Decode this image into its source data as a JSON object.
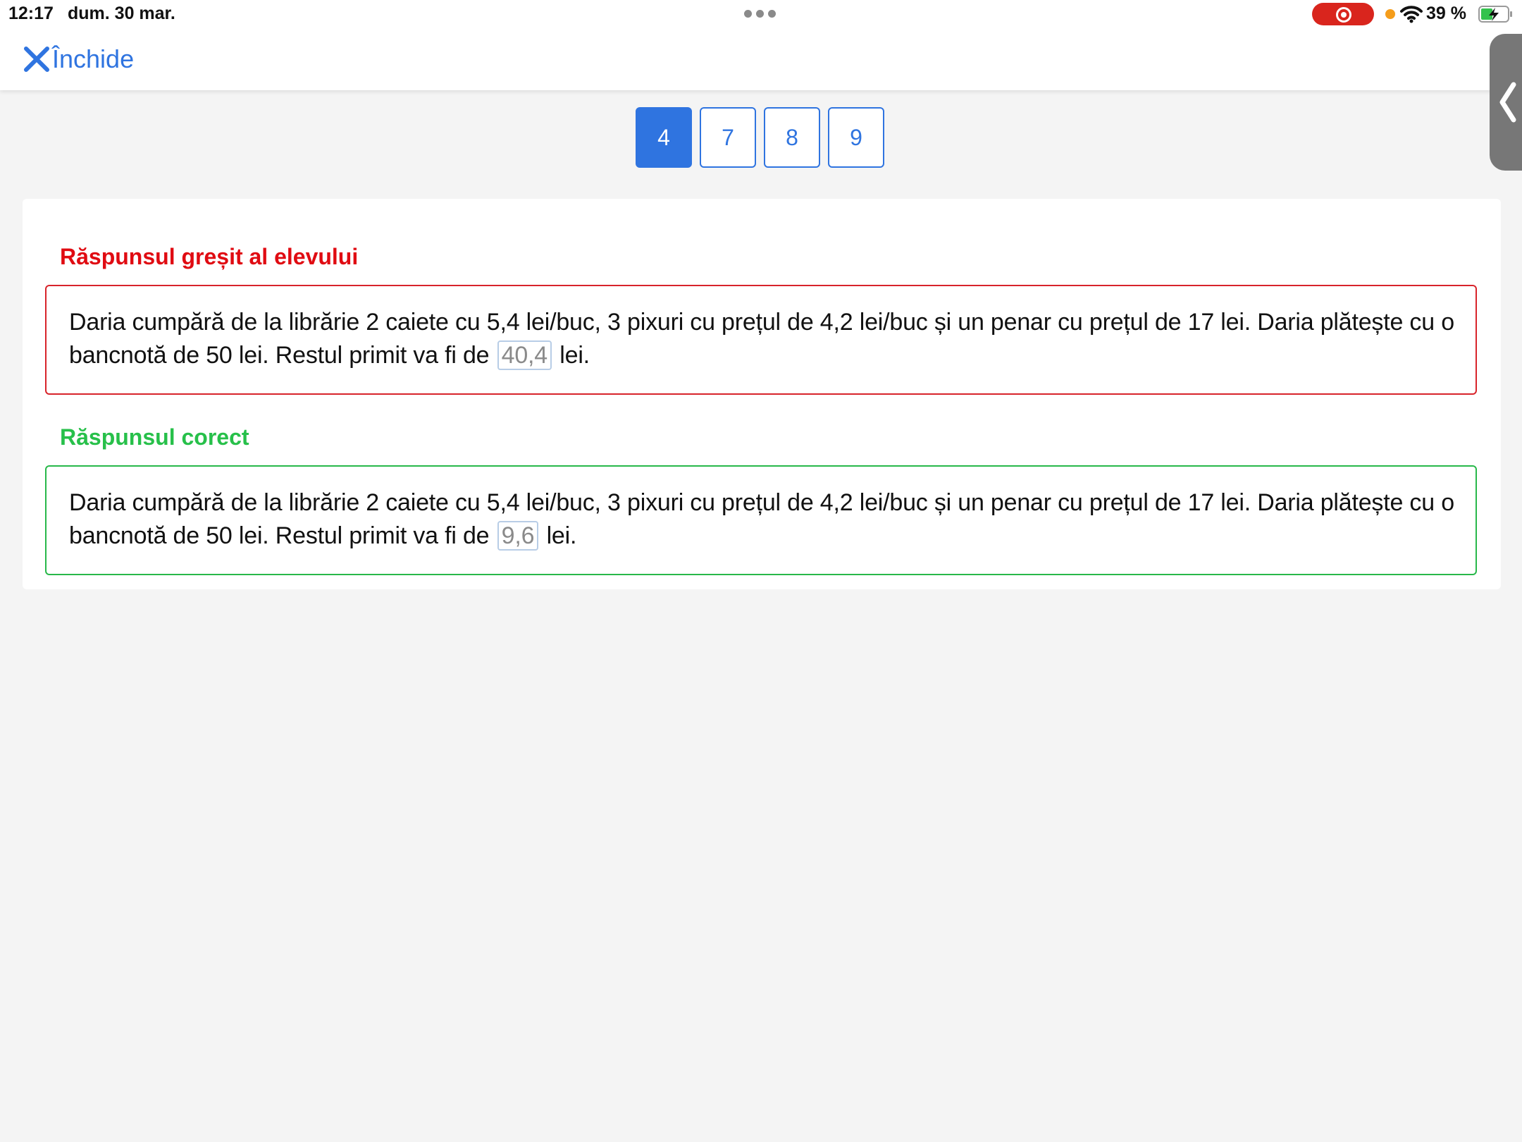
{
  "status_bar": {
    "time": "12:17",
    "date": "dum. 30 mar.",
    "battery_percent": "39 %",
    "recording_color": "#d9251d",
    "indicator_color": "#f59d1b"
  },
  "nav": {
    "close_label": "Închide",
    "accent_color": "#2f74e0"
  },
  "pager": {
    "pages": [
      "4",
      "7",
      "8",
      "9"
    ],
    "active": "4"
  },
  "wrong_answer": {
    "title": "Răspunsul greșit al elevului",
    "text_before": "Daria cumpără de la librărie 2 caiete cu 5,4 lei/buc, 3 pixuri cu prețul de 4,2 lei/buc și un penar cu prețul de 17 lei. Daria plătește cu o bancnotă de 50 lei. Restul primit va fi de",
    "answer": "40,4",
    "text_after": "lei.",
    "color": "#e00b12"
  },
  "correct_answer": {
    "title": "Răspunsul corect",
    "text_before": "Daria cumpără de la librărie 2 caiete cu 5,4 lei/buc, 3 pixuri cu prețul de 4,2 lei/buc și un penar cu prețul de 17 lei. Daria plătește cu o bancnotă de 50 lei. Restul primit va fi de",
    "answer": "9,6",
    "text_after": "lei.",
    "color": "#27c04a"
  }
}
